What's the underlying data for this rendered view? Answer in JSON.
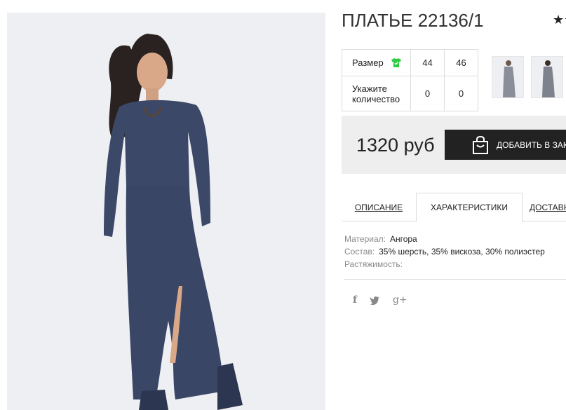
{
  "product": {
    "title": "ПЛАТЬЕ 22136/1",
    "rating_stars": "★☆"
  },
  "size_table": {
    "size_label": "Размер",
    "qty_label_line1": "Укажите",
    "qty_label_line2": "количество",
    "sizes": [
      "44",
      "46"
    ],
    "quantities": [
      "0",
      "0"
    ]
  },
  "price_block": {
    "price": "1320 руб",
    "button_label": "ДОБАВИТЬ В ЗАКАЗ"
  },
  "tabs": {
    "description": "ОПИСАНИЕ",
    "characteristics": "ХАРАКТЕРИСТИКИ",
    "delivery": "ДОСТАВКА"
  },
  "characteristics": [
    {
      "key": "Материал:",
      "value": "Ангора"
    },
    {
      "key": "Состав:",
      "value": "35% шерсть, 35% вискоза, 30% полиэстер"
    },
    {
      "key": "Растяжимость:",
      "value": ""
    }
  ],
  "social": {
    "facebook": "f",
    "twitter": "🐦",
    "googleplus": "g+"
  },
  "colors": {
    "dress": "#3b4868",
    "background": "#eeeff3",
    "button": "#222222",
    "size_icon": "#2ecc40"
  }
}
